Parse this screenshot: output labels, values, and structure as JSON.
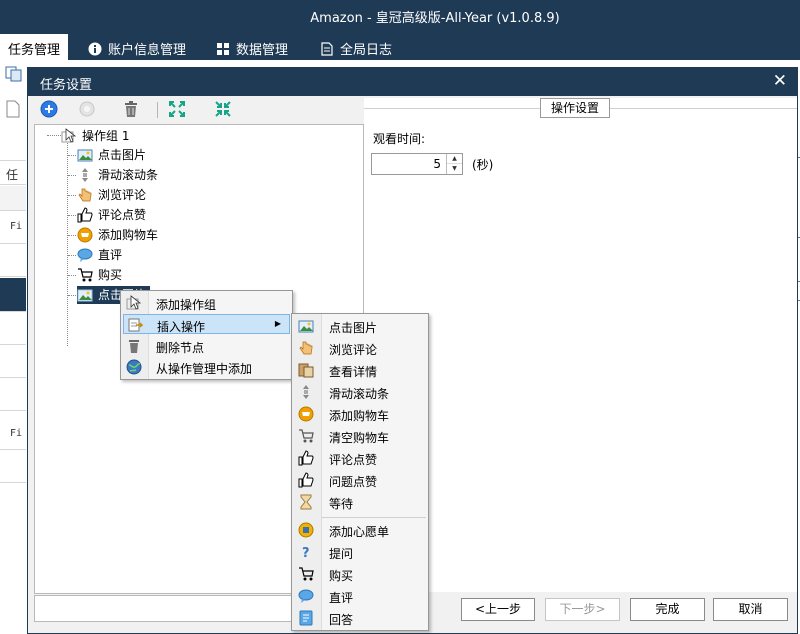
{
  "app": {
    "title": "Amazon - 皇冠高级版-All-Year  (v1.0.8.9)"
  },
  "main_tabs": [
    {
      "label": "任务管理",
      "active": true
    },
    {
      "label": "账户信息管理",
      "icon": "info-icon"
    },
    {
      "label": "数据管理",
      "icon": "grid-icon"
    },
    {
      "label": "全局日志",
      "icon": "log-icon"
    }
  ],
  "background": {
    "rows": [
      "任务",
      "Fi",
      "Fi"
    ]
  },
  "dialog": {
    "title": "任务设置",
    "close": "✕",
    "toolbar": [
      "add-icon",
      "disabled-circle-icon",
      "delete-icon",
      "expand-icon",
      "collapse-icon"
    ],
    "tree": {
      "root": "操作组 1",
      "children": [
        {
          "label": "点击图片",
          "icon": "image-icon"
        },
        {
          "label": "滑动滚动条",
          "icon": "scroll-icon"
        },
        {
          "label": "浏览评论",
          "icon": "hand-icon"
        },
        {
          "label": "评论点赞",
          "icon": "thumbs-up-icon"
        },
        {
          "label": "添加购物车",
          "icon": "cart-add-icon"
        },
        {
          "label": "直评",
          "icon": "chat-bubble-icon"
        },
        {
          "label": "购买",
          "icon": "cart-buy-icon"
        },
        {
          "label": "点击图片",
          "icon": "image-icon",
          "selected": true
        }
      ]
    },
    "settings": {
      "group_title": "操作设置",
      "watch_time_label": "观看时间:",
      "watch_time_value": "5",
      "unit": "(秒)"
    },
    "buttons": {
      "prev": "<上一步",
      "next": "下一步>",
      "finish": "完成",
      "cancel": "取消"
    }
  },
  "context_menu": {
    "items": [
      {
        "label": "添加操作组",
        "icon": "add-group-icon"
      },
      {
        "label": "插入操作",
        "icon": "insert-icon",
        "submenu": true,
        "highlighted": true
      },
      {
        "label": "删除节点",
        "icon": "trash-icon"
      },
      {
        "label": "从操作管理中添加",
        "icon": "globe-icon"
      }
    ]
  },
  "insert_submenu": {
    "items": [
      {
        "label": "点击图片",
        "icon": "image-icon"
      },
      {
        "label": "浏览评论",
        "icon": "hand-icon"
      },
      {
        "label": "查看详情",
        "icon": "details-icon"
      },
      {
        "label": "滑动滚动条",
        "icon": "scroll-icon"
      },
      {
        "label": "添加购物车",
        "icon": "cart-add-icon"
      },
      {
        "label": "清空购物车",
        "icon": "cart-clear-icon"
      },
      {
        "label": "评论点赞",
        "icon": "thumbs-up-icon"
      },
      {
        "label": "问题点赞",
        "icon": "thumbs-up-icon"
      },
      {
        "label": "等待",
        "icon": "hourglass-icon"
      },
      {
        "label": "添加心愿单",
        "icon": "wishlist-icon"
      },
      {
        "label": "提问",
        "icon": "question-icon"
      },
      {
        "label": "购买",
        "icon": "cart-buy-icon"
      },
      {
        "label": "直评",
        "icon": "chat-bubble-icon"
      },
      {
        "label": "回答",
        "icon": "answer-icon"
      }
    ]
  }
}
